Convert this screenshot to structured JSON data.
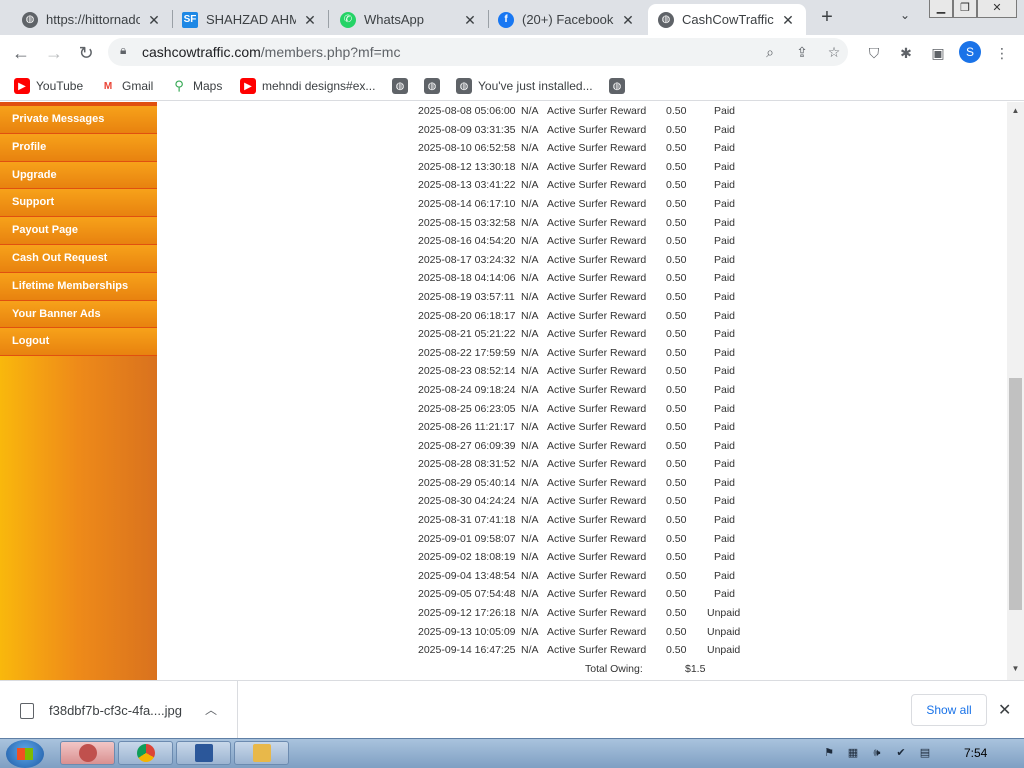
{
  "tabs": [
    {
      "label": "https://hittornado",
      "icon": "globe-icon"
    },
    {
      "label": "SHAHZAD AHMA",
      "icon": "sf-icon"
    },
    {
      "label": "WhatsApp",
      "icon": "whatsapp-icon"
    },
    {
      "label": "(20+) Facebook",
      "icon": "facebook-icon"
    },
    {
      "label": "CashCowTraffic.cc",
      "icon": "globe-icon",
      "active": true
    }
  ],
  "address": {
    "host": "cashcowtraffic.com",
    "path": "/members.php?mf=mc"
  },
  "profile_initial": "S",
  "bookmarks": [
    "YouTube",
    "Gmail",
    "Maps",
    "mehndi designs#ex...",
    "You've just installed..."
  ],
  "sidebar": {
    "items": [
      "Private Messages",
      "Profile",
      "Upgrade",
      "Support",
      "Payout Page",
      "Cash Out Request",
      "Lifetime Memberships",
      "Your Banner Ads",
      "Logout"
    ]
  },
  "transactions": [
    {
      "date": "2025-08-08 05:06:00",
      "ref": "N/A",
      "desc": "Active Surfer Reward",
      "amount": "0.50",
      "status": "Paid"
    },
    {
      "date": "2025-08-09 03:31:35",
      "ref": "N/A",
      "desc": "Active Surfer Reward",
      "amount": "0.50",
      "status": "Paid"
    },
    {
      "date": "2025-08-10 06:52:58",
      "ref": "N/A",
      "desc": "Active Surfer Reward",
      "amount": "0.50",
      "status": "Paid"
    },
    {
      "date": "2025-08-12 13:30:18",
      "ref": "N/A",
      "desc": "Active Surfer Reward",
      "amount": "0.50",
      "status": "Paid"
    },
    {
      "date": "2025-08-13 03:41:22",
      "ref": "N/A",
      "desc": "Active Surfer Reward",
      "amount": "0.50",
      "status": "Paid"
    },
    {
      "date": "2025-08-14 06:17:10",
      "ref": "N/A",
      "desc": "Active Surfer Reward",
      "amount": "0.50",
      "status": "Paid"
    },
    {
      "date": "2025-08-15 03:32:58",
      "ref": "N/A",
      "desc": "Active Surfer Reward",
      "amount": "0.50",
      "status": "Paid"
    },
    {
      "date": "2025-08-16 04:54:20",
      "ref": "N/A",
      "desc": "Active Surfer Reward",
      "amount": "0.50",
      "status": "Paid"
    },
    {
      "date": "2025-08-17 03:24:32",
      "ref": "N/A",
      "desc": "Active Surfer Reward",
      "amount": "0.50",
      "status": "Paid"
    },
    {
      "date": "2025-08-18 04:14:06",
      "ref": "N/A",
      "desc": "Active Surfer Reward",
      "amount": "0.50",
      "status": "Paid"
    },
    {
      "date": "2025-08-19 03:57:11",
      "ref": "N/A",
      "desc": "Active Surfer Reward",
      "amount": "0.50",
      "status": "Paid"
    },
    {
      "date": "2025-08-20 06:18:17",
      "ref": "N/A",
      "desc": "Active Surfer Reward",
      "amount": "0.50",
      "status": "Paid"
    },
    {
      "date": "2025-08-21 05:21:22",
      "ref": "N/A",
      "desc": "Active Surfer Reward",
      "amount": "0.50",
      "status": "Paid"
    },
    {
      "date": "2025-08-22 17:59:59",
      "ref": "N/A",
      "desc": "Active Surfer Reward",
      "amount": "0.50",
      "status": "Paid"
    },
    {
      "date": "2025-08-23 08:52:14",
      "ref": "N/A",
      "desc": "Active Surfer Reward",
      "amount": "0.50",
      "status": "Paid"
    },
    {
      "date": "2025-08-24 09:18:24",
      "ref": "N/A",
      "desc": "Active Surfer Reward",
      "amount": "0.50",
      "status": "Paid"
    },
    {
      "date": "2025-08-25 06:23:05",
      "ref": "N/A",
      "desc": "Active Surfer Reward",
      "amount": "0.50",
      "status": "Paid"
    },
    {
      "date": "2025-08-26 11:21:17",
      "ref": "N/A",
      "desc": "Active Surfer Reward",
      "amount": "0.50",
      "status": "Paid"
    },
    {
      "date": "2025-08-27 06:09:39",
      "ref": "N/A",
      "desc": "Active Surfer Reward",
      "amount": "0.50",
      "status": "Paid"
    },
    {
      "date": "2025-08-28 08:31:52",
      "ref": "N/A",
      "desc": "Active Surfer Reward",
      "amount": "0.50",
      "status": "Paid"
    },
    {
      "date": "2025-08-29 05:40:14",
      "ref": "N/A",
      "desc": "Active Surfer Reward",
      "amount": "0.50",
      "status": "Paid"
    },
    {
      "date": "2025-08-30 04:24:24",
      "ref": "N/A",
      "desc": "Active Surfer Reward",
      "amount": "0.50",
      "status": "Paid"
    },
    {
      "date": "2025-08-31 07:41:18",
      "ref": "N/A",
      "desc": "Active Surfer Reward",
      "amount": "0.50",
      "status": "Paid"
    },
    {
      "date": "2025-09-01 09:58:07",
      "ref": "N/A",
      "desc": "Active Surfer Reward",
      "amount": "0.50",
      "status": "Paid"
    },
    {
      "date": "2025-09-02 18:08:19",
      "ref": "N/A",
      "desc": "Active Surfer Reward",
      "amount": "0.50",
      "status": "Paid"
    },
    {
      "date": "2025-09-04 13:48:54",
      "ref": "N/A",
      "desc": "Active Surfer Reward",
      "amount": "0.50",
      "status": "Paid"
    },
    {
      "date": "2025-09-05 07:54:48",
      "ref": "N/A",
      "desc": "Active Surfer Reward",
      "amount": "0.50",
      "status": "Paid"
    },
    {
      "date": "2025-09-12 17:26:18",
      "ref": "N/A",
      "desc": "Active Surfer Reward",
      "amount": "0.50",
      "status": "Unpaid"
    },
    {
      "date": "2025-09-13 10:05:09",
      "ref": "N/A",
      "desc": "Active Surfer Reward",
      "amount": "0.50",
      "status": "Unpaid"
    },
    {
      "date": "2025-09-14 16:47:25",
      "ref": "N/A",
      "desc": "Active Surfer Reward",
      "amount": "0.50",
      "status": "Unpaid"
    }
  ],
  "total": {
    "label": "Total Owing:",
    "value": "$1.5"
  },
  "download": {
    "filename": "f38dbf7b-cf3c-4fa....jpg",
    "show_all": "Show all"
  },
  "taskbar": {
    "time": "7:54"
  },
  "colors": {
    "sidebar_orange": "#ee8a19",
    "link_blue": "#1a73e8",
    "profile_blue": "#1a73e8"
  }
}
